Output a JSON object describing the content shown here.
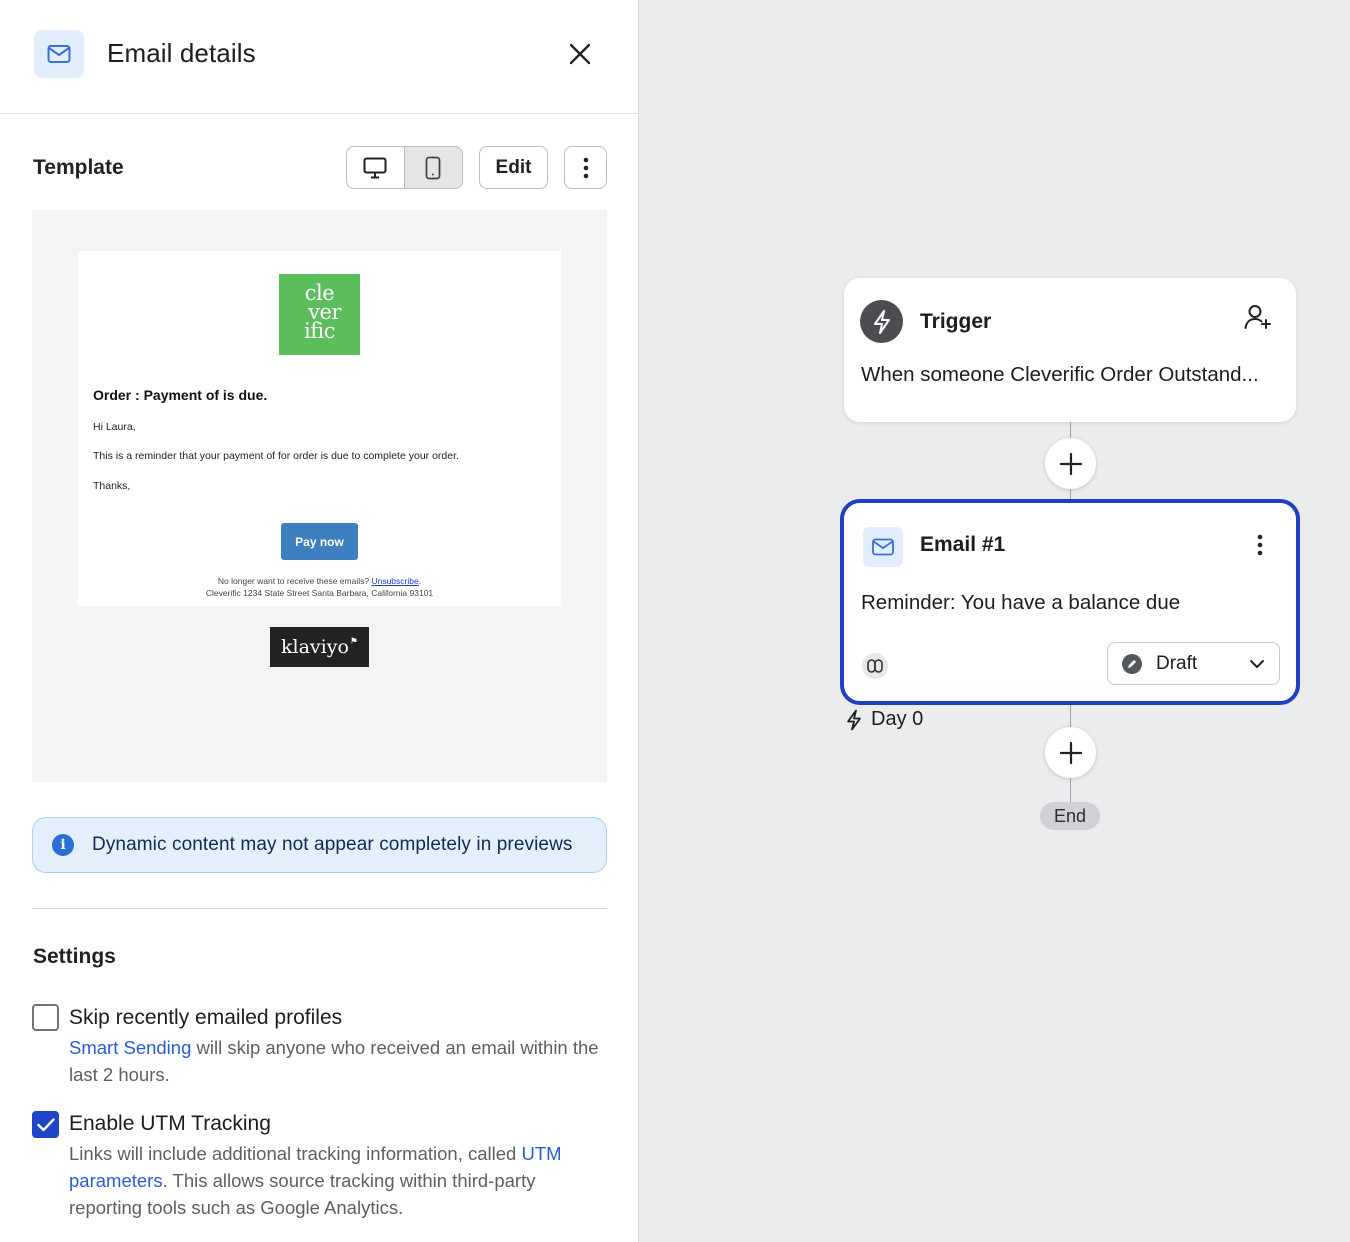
{
  "panel": {
    "title": "Email details",
    "header_icon": "mail-icon",
    "close_icon": "close-icon"
  },
  "template": {
    "label": "Template",
    "device_options": [
      "desktop-icon",
      "mobile-icon"
    ],
    "selected_device": "desktop",
    "edit_label": "Edit",
    "more_icon": "more-vertical-icon"
  },
  "email_preview": {
    "logo_text": [
      "cle",
      "ver",
      "ific"
    ],
    "heading": "Order : Payment of is due.",
    "greeting": "Hi Laura,",
    "body": "This is a reminder that your payment of for order is due to complete your order.",
    "closing": "Thanks,",
    "button_label": "Pay now",
    "footer_prefix": "No longer want to receive these emails?",
    "footer_link": "Unsubscribe",
    "footer_suffix": ".",
    "address": "Cleverific 1234 State Street Santa Barbara, California 93101",
    "badge_text": "klaviyo"
  },
  "info_banner": {
    "icon": "info-icon",
    "text": "Dynamic content may not appear completely in previews"
  },
  "settings": {
    "label": "Settings",
    "options": [
      {
        "title": "Skip recently emailed profiles",
        "checked": false,
        "desc_link": "Smart Sending",
        "desc_text": " will skip anyone who received an email within the last 2 hours."
      },
      {
        "title": "Enable UTM Tracking",
        "checked": true,
        "desc_pre": "Links will include additional tracking information, called ",
        "desc_link": "UTM parameters",
        "desc_post": ". This allows source tracking within third-party reporting tools such as Google Analytics."
      }
    ]
  },
  "flow": {
    "trigger": {
      "title": "Trigger",
      "description": "When someone Cleverific Order Outstand...",
      "icon": "lightning-icon",
      "action_icon": "add-person-icon"
    },
    "email_node": {
      "title": "Email #1",
      "subject": "Reminder: You have a balance due",
      "status": "Draft",
      "link_icon": "link-icon",
      "selected": true
    },
    "day_label": "Day 0",
    "end_label": "End"
  },
  "colors": {
    "accent": "#1f44c9",
    "link": "#2a5bd7",
    "logo_green": "#5bbd5b",
    "pay_button": "#3e7fc0",
    "info_bg": "#e3f0fc"
  }
}
